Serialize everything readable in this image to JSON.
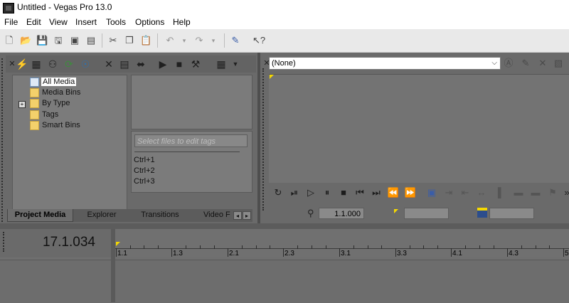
{
  "window": {
    "title": "Untitled - Vegas Pro 13.0"
  },
  "menu": {
    "items": [
      "File",
      "Edit",
      "View",
      "Insert",
      "Tools",
      "Options",
      "Help"
    ]
  },
  "toolbar": {
    "icons": [
      "new-icon",
      "open-icon",
      "save-icon",
      "save-as-icon",
      "render-icon",
      "cut-icon",
      "copy-icon",
      "paste-icon",
      "undo-icon",
      "redo-icon",
      "edit-tool-icon",
      "help-pointer-icon"
    ]
  },
  "project_media": {
    "tree": [
      {
        "label": "All Media",
        "selected": true
      },
      {
        "label": "Media Bins"
      },
      {
        "label": "By Type",
        "expandable": true,
        "expander": "+"
      },
      {
        "label": "Tags"
      },
      {
        "label": "Smart Bins"
      }
    ],
    "tag_search_placeholder": "Select files to edit tags",
    "shortcuts": [
      "Ctrl+1",
      "Ctrl+2",
      "Ctrl+3"
    ],
    "tabs": [
      {
        "label": "Project Media",
        "active": true
      },
      {
        "label": "Explorer"
      },
      {
        "label": "Transitions"
      },
      {
        "label": "Video F"
      }
    ],
    "tab_arrows": {
      "left": "◂",
      "right": "▸"
    }
  },
  "video_preview": {
    "preset": "(None)",
    "cursor_time": "1.1.000"
  },
  "timeline": {
    "timecode": "17.1.034",
    "ruler_labels": [
      "1.1",
      "1.3",
      "2.1",
      "2.3",
      "3.1",
      "3.3",
      "4.1",
      "4.3",
      "5"
    ]
  },
  "colors": {
    "panel": "#6a6a6a",
    "toolbar": "#e9e9e9",
    "folder": "#f3d16b",
    "marker": "#f5d800"
  }
}
